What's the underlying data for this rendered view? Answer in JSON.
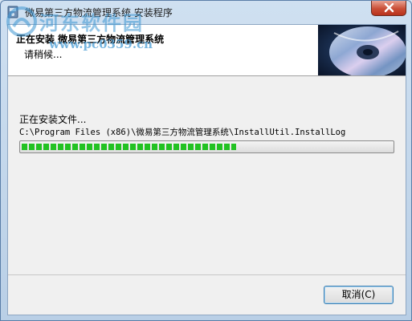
{
  "window": {
    "title": "微易第三方物流管理系统 安装程序"
  },
  "header": {
    "title": "正在安装 微易第三方物流管理系统",
    "subtitle": "请稍候..."
  },
  "watermark": {
    "name": "河东软件园",
    "url": "www.pc0359.cn"
  },
  "main": {
    "status": "正在安装文件...",
    "current_path": "C:\\Program Files (x86)\\微易第三方物流管理系统\\InstallUtil.InstallLog",
    "progress_fraction": 0.58
  },
  "footer": {
    "cancel_label": "取消(C)"
  },
  "colors": {
    "progress": "#22c222",
    "close_button": "#c94e36"
  },
  "icons": [
    "installer-app-icon",
    "close-icon",
    "cd-disc-icon",
    "watermark-logo-icon"
  ]
}
